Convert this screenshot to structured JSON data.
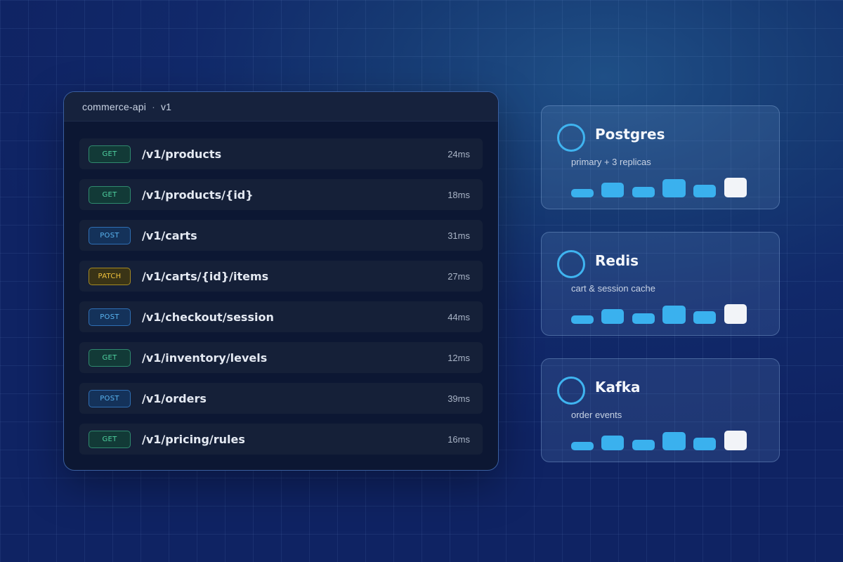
{
  "api": {
    "service": "commerce-api",
    "separator": "·",
    "version": "v1",
    "endpoints": [
      {
        "method": "GET",
        "path": "/v1/products",
        "latency": "24ms"
      },
      {
        "method": "GET",
        "path": "/v1/products/{id}",
        "latency": "18ms"
      },
      {
        "method": "POST",
        "path": "/v1/carts",
        "latency": "31ms"
      },
      {
        "method": "PATCH",
        "path": "/v1/carts/{id}/items",
        "latency": "27ms"
      },
      {
        "method": "POST",
        "path": "/v1/checkout/session",
        "latency": "44ms"
      },
      {
        "method": "GET",
        "path": "/v1/inventory/levels",
        "latency": "12ms"
      },
      {
        "method": "POST",
        "path": "/v1/orders",
        "latency": "39ms"
      },
      {
        "method": "GET",
        "path": "/v1/pricing/rules",
        "latency": "16ms"
      }
    ]
  },
  "services": [
    {
      "name": "Postgres",
      "description": "primary + 3 replicas",
      "icon": "status-ring-icon"
    },
    {
      "name": "Redis",
      "description": "cart & session cache",
      "icon": "status-ring-icon"
    },
    {
      "name": "Kafka",
      "description": "order events",
      "icon": "status-ring-icon"
    }
  ],
  "colors": {
    "get": "#4fd1a0",
    "post": "#59b4f0",
    "patch": "#f0c23c",
    "accent": "#3ab1ee"
  }
}
